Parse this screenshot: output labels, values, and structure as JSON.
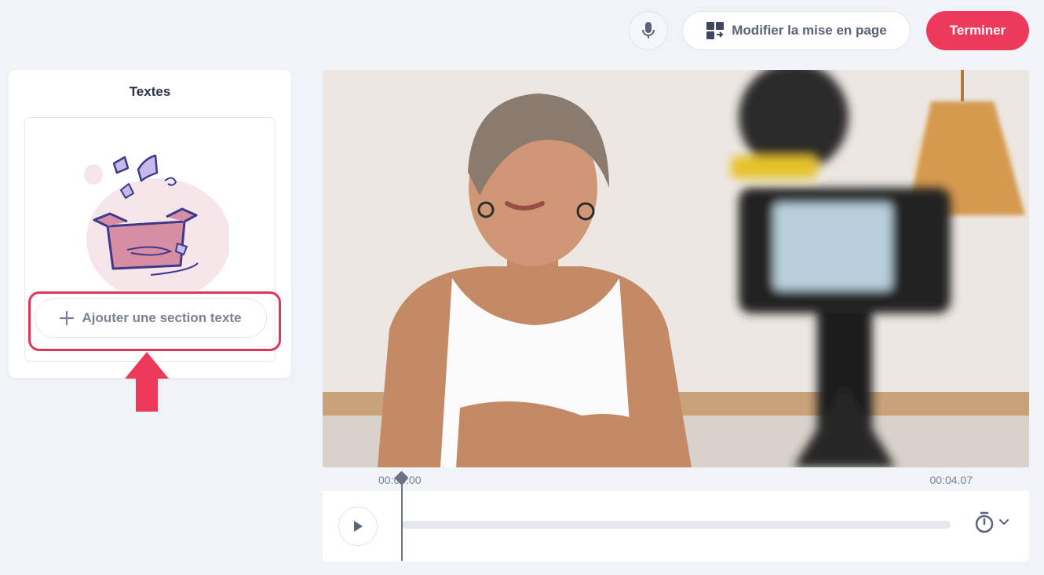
{
  "toolbar": {
    "layout_label": "Modifier la mise en page",
    "finish_label": "Terminer"
  },
  "left_panel": {
    "title": "Textes",
    "add_section_label": "Ajouter une section texte"
  },
  "timeline": {
    "current_time": "00:00.00",
    "duration": "00:04.07"
  },
  "colors": {
    "accent": "#ee3a5a",
    "background": "#f0f3f8",
    "illustration_pink": "#d88ea2",
    "illustration_purple": "#3d3a8c"
  },
  "icons": {
    "mic": "microphone-icon",
    "layout": "layout-grid-icon",
    "add": "plus-icon",
    "play": "play-icon",
    "timer": "stopwatch-icon",
    "chevron": "chevron-down-icon"
  }
}
